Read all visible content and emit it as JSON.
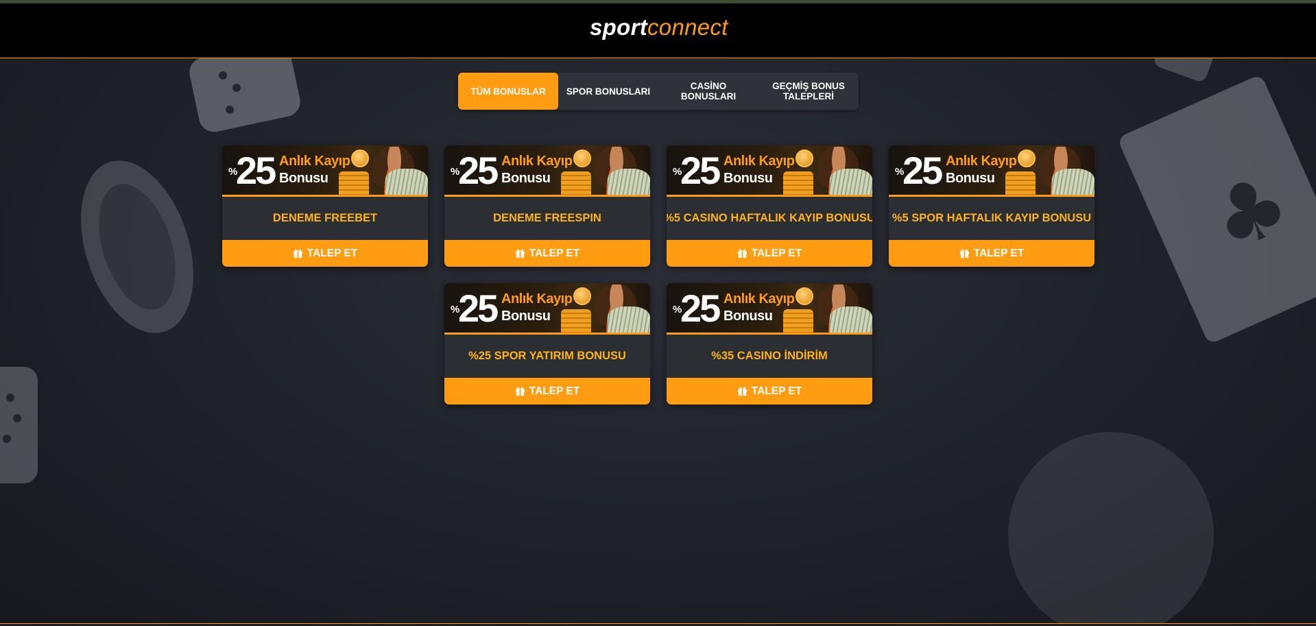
{
  "header": {
    "logo_bold": "sport",
    "logo_light": "connect"
  },
  "tabs": [
    {
      "label": "TÜM BONUSLAR",
      "active": true
    },
    {
      "label": "SPOR BONUSLARI",
      "active": false
    },
    {
      "label": "CASİNO BONUSLARI",
      "active": false
    },
    {
      "label": "GEÇMİŞ BONUS TALEPLERİ",
      "active": false
    }
  ],
  "banner": {
    "percent_sign": "%",
    "number": "25",
    "line1": "Anlık Kayıp",
    "line2": "Bonusu"
  },
  "bonuses": [
    {
      "title": "DENEME FREEBET",
      "button": "TALEP ET",
      "icon": "gift-icon"
    },
    {
      "title": "DENEME FREESPIN",
      "button": "TALEP ET",
      "icon": "gift-icon"
    },
    {
      "title": "%5 CASINO HAFTALIK KAYIP BONUSU",
      "button": "TALEP ET",
      "icon": "gift-icon"
    },
    {
      "title": "%5 SPOR HAFTALIK KAYIP BONUSU",
      "button": "TALEP ET",
      "icon": "gift-icon"
    },
    {
      "title": "%25 SPOR YATIRIM BONUSU",
      "button": "TALEP ET",
      "icon": "gift-icon"
    },
    {
      "title": "%35 CASINO İNDİRİM",
      "button": "TALEP ET",
      "icon": "gift-icon"
    }
  ],
  "colors": {
    "accent": "#ff9c12",
    "title_text": "#ffb21a",
    "card_bg": "#2b2e33",
    "header_bg": "#000000"
  }
}
